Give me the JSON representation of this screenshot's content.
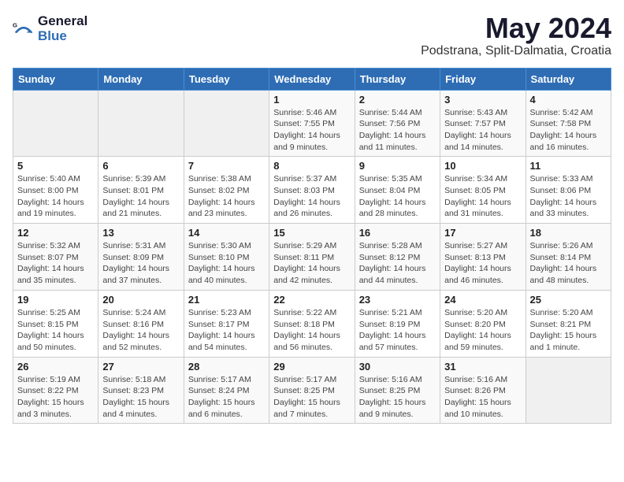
{
  "header": {
    "logo_general": "General",
    "logo_blue": "Blue",
    "month_title": "May 2024",
    "location": "Podstrana, Split-Dalmatia, Croatia"
  },
  "days_of_week": [
    "Sunday",
    "Monday",
    "Tuesday",
    "Wednesday",
    "Thursday",
    "Friday",
    "Saturday"
  ],
  "weeks": [
    [
      {
        "day": "",
        "info": ""
      },
      {
        "day": "",
        "info": ""
      },
      {
        "day": "",
        "info": ""
      },
      {
        "day": "1",
        "info": "Sunrise: 5:46 AM\nSunset: 7:55 PM\nDaylight: 14 hours\nand 9 minutes."
      },
      {
        "day": "2",
        "info": "Sunrise: 5:44 AM\nSunset: 7:56 PM\nDaylight: 14 hours\nand 11 minutes."
      },
      {
        "day": "3",
        "info": "Sunrise: 5:43 AM\nSunset: 7:57 PM\nDaylight: 14 hours\nand 14 minutes."
      },
      {
        "day": "4",
        "info": "Sunrise: 5:42 AM\nSunset: 7:58 PM\nDaylight: 14 hours\nand 16 minutes."
      }
    ],
    [
      {
        "day": "5",
        "info": "Sunrise: 5:40 AM\nSunset: 8:00 PM\nDaylight: 14 hours\nand 19 minutes."
      },
      {
        "day": "6",
        "info": "Sunrise: 5:39 AM\nSunset: 8:01 PM\nDaylight: 14 hours\nand 21 minutes."
      },
      {
        "day": "7",
        "info": "Sunrise: 5:38 AM\nSunset: 8:02 PM\nDaylight: 14 hours\nand 23 minutes."
      },
      {
        "day": "8",
        "info": "Sunrise: 5:37 AM\nSunset: 8:03 PM\nDaylight: 14 hours\nand 26 minutes."
      },
      {
        "day": "9",
        "info": "Sunrise: 5:35 AM\nSunset: 8:04 PM\nDaylight: 14 hours\nand 28 minutes."
      },
      {
        "day": "10",
        "info": "Sunrise: 5:34 AM\nSunset: 8:05 PM\nDaylight: 14 hours\nand 31 minutes."
      },
      {
        "day": "11",
        "info": "Sunrise: 5:33 AM\nSunset: 8:06 PM\nDaylight: 14 hours\nand 33 minutes."
      }
    ],
    [
      {
        "day": "12",
        "info": "Sunrise: 5:32 AM\nSunset: 8:07 PM\nDaylight: 14 hours\nand 35 minutes."
      },
      {
        "day": "13",
        "info": "Sunrise: 5:31 AM\nSunset: 8:09 PM\nDaylight: 14 hours\nand 37 minutes."
      },
      {
        "day": "14",
        "info": "Sunrise: 5:30 AM\nSunset: 8:10 PM\nDaylight: 14 hours\nand 40 minutes."
      },
      {
        "day": "15",
        "info": "Sunrise: 5:29 AM\nSunset: 8:11 PM\nDaylight: 14 hours\nand 42 minutes."
      },
      {
        "day": "16",
        "info": "Sunrise: 5:28 AM\nSunset: 8:12 PM\nDaylight: 14 hours\nand 44 minutes."
      },
      {
        "day": "17",
        "info": "Sunrise: 5:27 AM\nSunset: 8:13 PM\nDaylight: 14 hours\nand 46 minutes."
      },
      {
        "day": "18",
        "info": "Sunrise: 5:26 AM\nSunset: 8:14 PM\nDaylight: 14 hours\nand 48 minutes."
      }
    ],
    [
      {
        "day": "19",
        "info": "Sunrise: 5:25 AM\nSunset: 8:15 PM\nDaylight: 14 hours\nand 50 minutes."
      },
      {
        "day": "20",
        "info": "Sunrise: 5:24 AM\nSunset: 8:16 PM\nDaylight: 14 hours\nand 52 minutes."
      },
      {
        "day": "21",
        "info": "Sunrise: 5:23 AM\nSunset: 8:17 PM\nDaylight: 14 hours\nand 54 minutes."
      },
      {
        "day": "22",
        "info": "Sunrise: 5:22 AM\nSunset: 8:18 PM\nDaylight: 14 hours\nand 56 minutes."
      },
      {
        "day": "23",
        "info": "Sunrise: 5:21 AM\nSunset: 8:19 PM\nDaylight: 14 hours\nand 57 minutes."
      },
      {
        "day": "24",
        "info": "Sunrise: 5:20 AM\nSunset: 8:20 PM\nDaylight: 14 hours\nand 59 minutes."
      },
      {
        "day": "25",
        "info": "Sunrise: 5:20 AM\nSunset: 8:21 PM\nDaylight: 15 hours\nand 1 minute."
      }
    ],
    [
      {
        "day": "26",
        "info": "Sunrise: 5:19 AM\nSunset: 8:22 PM\nDaylight: 15 hours\nand 3 minutes."
      },
      {
        "day": "27",
        "info": "Sunrise: 5:18 AM\nSunset: 8:23 PM\nDaylight: 15 hours\nand 4 minutes."
      },
      {
        "day": "28",
        "info": "Sunrise: 5:17 AM\nSunset: 8:24 PM\nDaylight: 15 hours\nand 6 minutes."
      },
      {
        "day": "29",
        "info": "Sunrise: 5:17 AM\nSunset: 8:25 PM\nDaylight: 15 hours\nand 7 minutes."
      },
      {
        "day": "30",
        "info": "Sunrise: 5:16 AM\nSunset: 8:25 PM\nDaylight: 15 hours\nand 9 minutes."
      },
      {
        "day": "31",
        "info": "Sunrise: 5:16 AM\nSunset: 8:26 PM\nDaylight: 15 hours\nand 10 minutes."
      },
      {
        "day": "",
        "info": ""
      }
    ]
  ]
}
